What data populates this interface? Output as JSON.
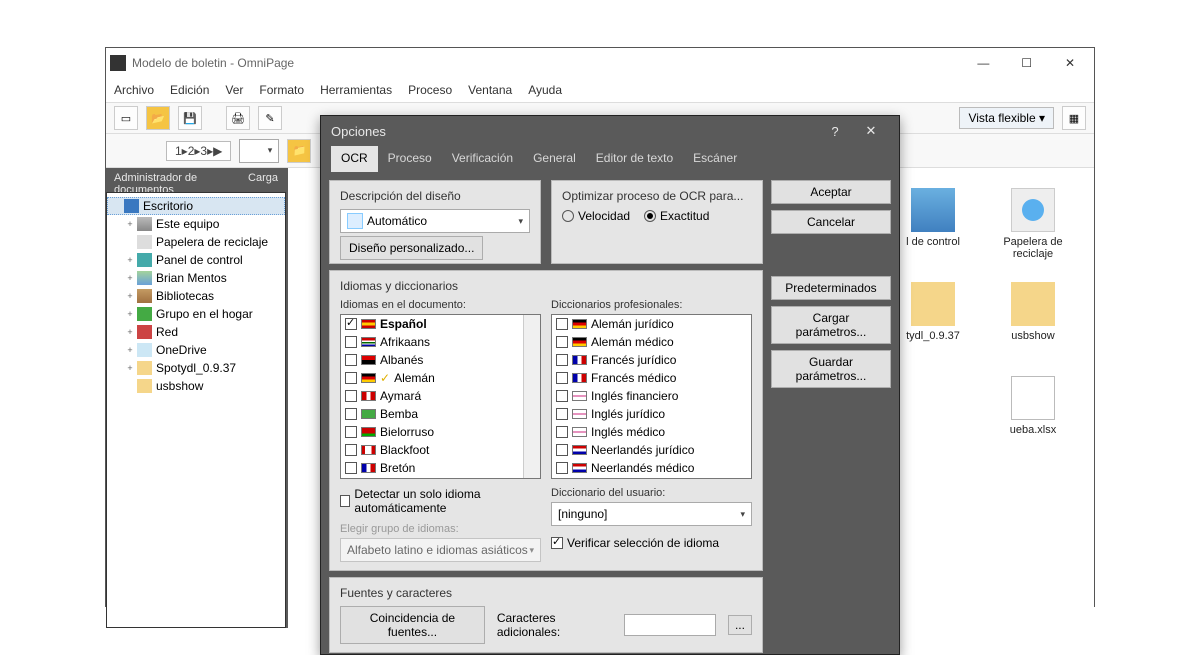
{
  "window": {
    "title": "Modelo de boletin - OmniPage",
    "min": "—",
    "max": "☐",
    "close": "✕"
  },
  "menu": [
    "Archivo",
    "Edición",
    "Ver",
    "Formato",
    "Herramientas",
    "Proceso",
    "Ventana",
    "Ayuda"
  ],
  "toolbar": {
    "vista": "Vista flexible",
    "vista_caret": "▾",
    "steps": "1▸2▸3▸▶",
    "page_combo": ""
  },
  "panes": {
    "tab1": "Administrador de documentos",
    "tab2": "Carga"
  },
  "tree": [
    {
      "label": "Escritorio",
      "icon": "t-desktop",
      "indent": 0,
      "toggle": "",
      "selected": true
    },
    {
      "label": "Este equipo",
      "icon": "t-pc",
      "indent": 1,
      "toggle": "+"
    },
    {
      "label": "Papelera de reciclaje",
      "icon": "t-bin",
      "indent": 1,
      "toggle": ""
    },
    {
      "label": "Panel de control",
      "icon": "t-panel",
      "indent": 1,
      "toggle": "+"
    },
    {
      "label": "Brian Mentos",
      "icon": "t-user",
      "indent": 1,
      "toggle": "+"
    },
    {
      "label": "Bibliotecas",
      "icon": "t-lib",
      "indent": 1,
      "toggle": "+"
    },
    {
      "label": "Grupo en el hogar",
      "icon": "t-group",
      "indent": 1,
      "toggle": "+"
    },
    {
      "label": "Red",
      "icon": "t-net",
      "indent": 1,
      "toggle": "+"
    },
    {
      "label": "OneDrive",
      "icon": "t-cloud",
      "indent": 1,
      "toggle": "+"
    },
    {
      "label": "Spotydl_0.9.37",
      "icon": "t-folder",
      "indent": 1,
      "toggle": "+"
    },
    {
      "label": "usbshow",
      "icon": "t-folder",
      "indent": 1,
      "toggle": ""
    }
  ],
  "desktop": [
    {
      "label": "l de control",
      "icon": "di-panel"
    },
    {
      "label": "Papelera de reciclaje",
      "icon": "di-bin"
    },
    {
      "label": "tydl_0.9.37",
      "icon": "di-folder"
    },
    {
      "label": "usbshow",
      "icon": "di-folder"
    },
    {
      "label": "ueba.xlsx",
      "icon": "di-file"
    }
  ],
  "dialog": {
    "title": "Opciones",
    "help": "?",
    "close": "✕",
    "tabs": [
      "OCR",
      "Proceso",
      "Verificación",
      "General",
      "Editor de texto",
      "Escáner"
    ],
    "active_tab": 0,
    "side_buttons": {
      "accept": "Aceptar",
      "cancel": "Cancelar",
      "defaults": "Predeterminados",
      "load": "Cargar parámetros...",
      "save": "Guardar parámetros..."
    },
    "sec_design": {
      "title": "Descripción del diseño",
      "combo": "Automático",
      "btn": "Diseño personalizado..."
    },
    "sec_optim": {
      "title": "Optimizar proceso de OCR para...",
      "r1": "Velocidad",
      "r2": "Exactitud",
      "selected": "r2"
    },
    "sec_lang": {
      "title": "Idiomas y diccionarios",
      "list1_label": "Idiomas en el documento:",
      "list2_label": "Diccionarios profesionales:",
      "list1": [
        {
          "name": "Español",
          "flag": "f-es",
          "checked": true
        },
        {
          "name": "Afrikaans",
          "flag": "f-za",
          "checked": false
        },
        {
          "name": "Albanés",
          "flag": "f-al",
          "checked": false
        },
        {
          "name": "Alemán",
          "flag": "f-de",
          "checked": false,
          "mark": true
        },
        {
          "name": "Aymará",
          "flag": "f-pe",
          "checked": false
        },
        {
          "name": "Bemba",
          "flag": "f-zm",
          "checked": false
        },
        {
          "name": "Bielorruso",
          "flag": "f-by",
          "checked": false
        },
        {
          "name": "Blackfoot",
          "flag": "f-ca",
          "checked": false
        },
        {
          "name": "Bretón",
          "flag": "f-fr",
          "checked": false
        }
      ],
      "list2": [
        {
          "name": "Alemán jurídico",
          "flag": "f-de",
          "checked": false
        },
        {
          "name": "Alemán médico",
          "flag": "f-de",
          "checked": false
        },
        {
          "name": "Francés jurídico",
          "flag": "f-fr",
          "checked": false
        },
        {
          "name": "Francés médico",
          "flag": "f-fr",
          "checked": false
        },
        {
          "name": "Inglés financiero",
          "flag": "f-gb",
          "checked": false
        },
        {
          "name": "Inglés jurídico",
          "flag": "f-gb",
          "checked": false
        },
        {
          "name": "Inglés médico",
          "flag": "f-gb",
          "checked": false
        },
        {
          "name": "Neerlandés jurídico",
          "flag": "f-nl",
          "checked": false
        },
        {
          "name": "Neerlandés médico",
          "flag": "f-nl",
          "checked": false
        }
      ],
      "auto_detect": "Detectar un solo idioma automáticamente",
      "group_label": "Elegir grupo de idiomas:",
      "group_combo": "Alfabeto latino e idiomas asiáticos",
      "user_dict_label": "Diccionario del usuario:",
      "user_dict_combo": "[ninguno]",
      "verify": "Verificar selección de idioma"
    },
    "sec_fonts": {
      "title": "Fuentes y caracteres",
      "btn": "Coincidencia de fuentes...",
      "extra_label": "Caracteres adicionales:",
      "ellipsis": "..."
    }
  }
}
